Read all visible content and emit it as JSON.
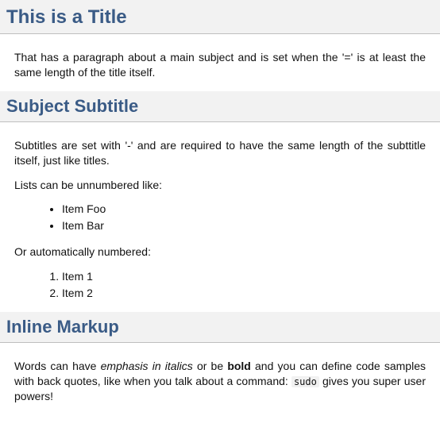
{
  "section1": {
    "title": "This is a Title",
    "para": "That has a paragraph about a main subject and is set when the '=' is at least the same length of the title itself."
  },
  "section2": {
    "title": "Subject Subtitle",
    "para1": "Subtitles are set with '-' and are required to have the same length of the subttitle itself, just like titles.",
    "para2": "Lists can be unnumbered like:",
    "ul": [
      "Item Foo",
      "Item Bar"
    ],
    "para3": "Or automatically numbered:",
    "ol": [
      "Item 1",
      "Item 2"
    ]
  },
  "section3": {
    "title": "Inline Markup",
    "para": {
      "t1": "Words can have ",
      "em": "emphasis in italics",
      "t2": " or be ",
      "b": "bold",
      "t3": " and you can define code samples with back quotes, like when you talk about a command: ",
      "code": "sudo",
      "t4": " gives you super user powers!"
    }
  }
}
